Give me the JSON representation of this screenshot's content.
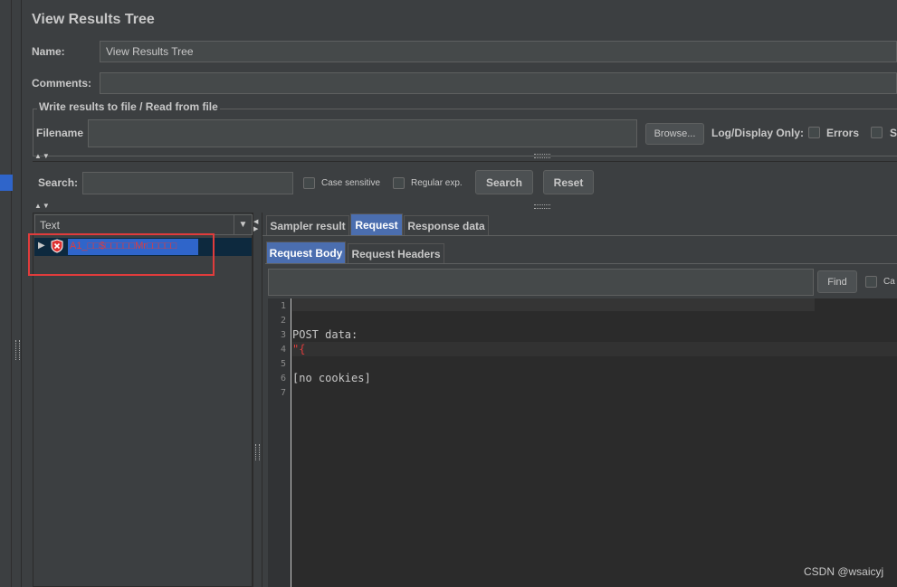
{
  "panel": {
    "title": "View Results Tree",
    "name_label": "Name:",
    "name_value": "View Results Tree",
    "comments_label": "Comments:",
    "comments_value": "",
    "fileset_legend": "Write results to file / Read from file",
    "filename_label": "Filename",
    "filename_value": "",
    "browse_label": "Browse...",
    "log_display_label": "Log/Display Only:",
    "errors_label": "Errors",
    "successes_label_partial": "S"
  },
  "search": {
    "label": "Search:",
    "value": "",
    "case_sensitive_label": "Case sensitive",
    "regex_label": "Regular exp.",
    "search_button": "Search",
    "reset_button": "Reset"
  },
  "tree": {
    "renderer_value": "Text",
    "items": [
      {
        "label": "A1_□□$□□□□□Mr□□□□□",
        "status": "error"
      }
    ]
  },
  "result_tabs": [
    {
      "label": "Sampler result",
      "active": false
    },
    {
      "label": "Request",
      "active": true
    },
    {
      "label": "Response data",
      "active": false
    }
  ],
  "request_tabs": [
    {
      "label": "Request Body",
      "active": true
    },
    {
      "label": "Request Headers",
      "active": false
    }
  ],
  "find": {
    "value": "",
    "button": "Find",
    "case_label_partial": "Ca"
  },
  "editor": {
    "line_numbers": [
      "1",
      "2",
      "3",
      "4",
      "5",
      "6",
      "7"
    ],
    "lines": [
      "",
      "",
      "POST data:",
      "\"{",
      "",
      "[no cookies]",
      ""
    ]
  },
  "watermark": "CSDN @wsaicyj",
  "colors": {
    "accent": "#4b6eaf",
    "error_text": "#e03c3c",
    "highlight_box": "#e03c3c"
  },
  "icons": {
    "expand": "triangle-right-icon",
    "error": "shield-error-icon",
    "dropdown": "chevron-down-icon"
  }
}
